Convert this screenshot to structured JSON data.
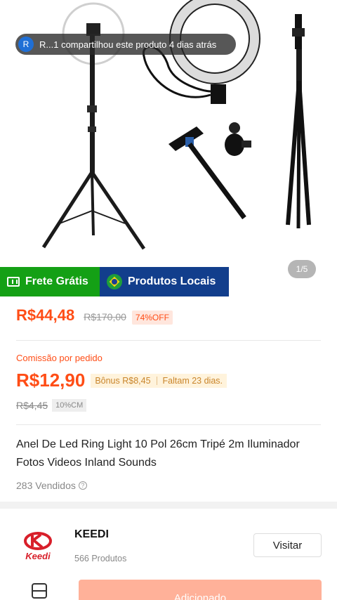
{
  "share_banner": {
    "avatar_letter": "R",
    "text": "R...1 compartilhou este produto 4 dias atrás"
  },
  "gallery": {
    "indicator": "1/5"
  },
  "badges": {
    "free_shipping": "Frete Grátis",
    "local_products": "Produtos Locais"
  },
  "price": {
    "current": "R$44,48",
    "original": "R$170,00",
    "discount": "74%OFF"
  },
  "commission": {
    "label": "Comissão por pedido",
    "value": "R$12,90",
    "bonus": "Bônus R$8,45",
    "remaining": "Faltam 23 dias.",
    "old_value": "R$4,45",
    "rate": "10%CM"
  },
  "product": {
    "title": "Anel De Led Ring Light 10 Pol 26cm Tripé 2m Iluminador Fotos Videos Inland Sounds",
    "sold": "283 Vendidos"
  },
  "store": {
    "logo_text": "Keedi",
    "name": "KEEDI",
    "products": "566 Produtos",
    "visit_label": "Visitar"
  },
  "bottom_bar": {
    "add_label": "Adicionado"
  },
  "colors": {
    "accent": "#ff4d16",
    "free_shipping_bg": "#14a015",
    "local_products_bg": "#123e8c"
  }
}
